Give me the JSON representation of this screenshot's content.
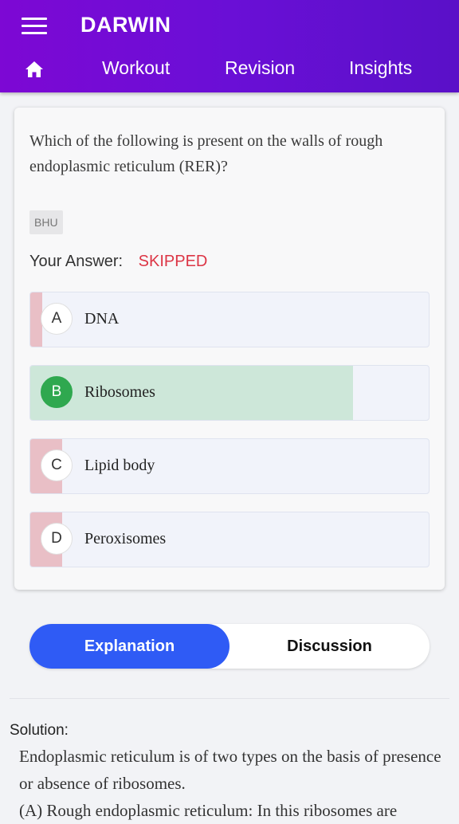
{
  "app": {
    "title": "DARWIN"
  },
  "nav": {
    "items": [
      "Workout",
      "Revision",
      "Insights"
    ]
  },
  "icons": {
    "menu": "hamburger-icon",
    "home": "home-icon"
  },
  "colors": {
    "header": "#7d08d4",
    "skipped": "#dc3545",
    "correct": "#2fa84f",
    "tab_active": "#2f5bf5"
  },
  "question": {
    "text": "Which of the following is present on the walls of rough endoplasmic reticulum (RER)?",
    "tag": "BHU",
    "answer_label": "Your Answer:",
    "answer_value": "SKIPPED"
  },
  "options": [
    {
      "letter": "A",
      "text": "DNA",
      "status": "wrong",
      "percent": 3
    },
    {
      "letter": "B",
      "text": "Ribosomes",
      "status": "correct",
      "percent": 81
    },
    {
      "letter": "C",
      "text": "Lipid body",
      "status": "wrong",
      "percent": 8
    },
    {
      "letter": "D",
      "text": "Peroxisomes",
      "status": "wrong",
      "percent": 8
    }
  ],
  "tabs": {
    "active": "Explanation",
    "inactive": "Discussion"
  },
  "solution": {
    "title": "Solution:",
    "lines": [
      "Endoplasmic reticulum is of two types on the basis of presence or absence of ribosomes.",
      "(A) Rough endoplasmic reticulum: In this ribosomes are"
    ]
  }
}
